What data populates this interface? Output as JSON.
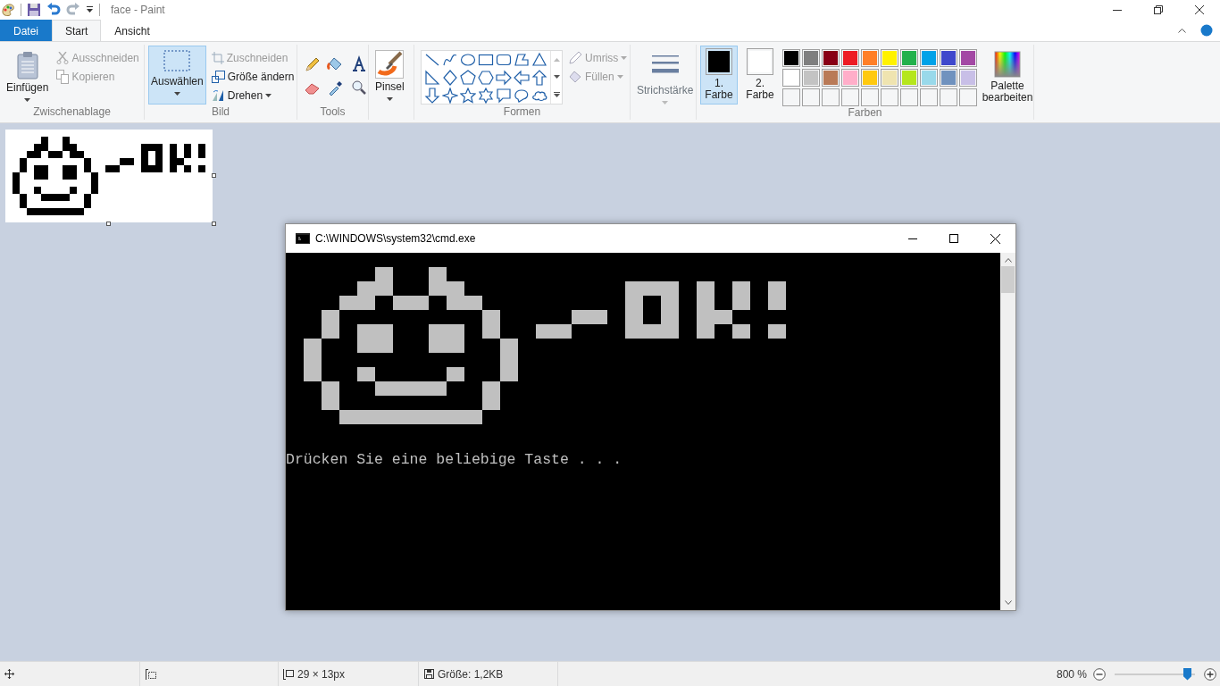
{
  "window": {
    "title": "face - Paint"
  },
  "tabs": [
    {
      "label": "Datei",
      "kind": "file",
      "selected": false
    },
    {
      "label": "Start",
      "kind": "tab",
      "selected": true
    },
    {
      "label": "Ansicht",
      "kind": "tab",
      "selected": false
    }
  ],
  "clipboard": {
    "label": "Zwischenablage",
    "paste": {
      "label": "Einfügen"
    },
    "cut": {
      "label": "Ausschneiden",
      "disabled": true
    },
    "copy": {
      "label": "Kopieren",
      "disabled": true
    }
  },
  "image": {
    "label": "Bild",
    "select": {
      "label": "Auswählen",
      "selected": true
    },
    "crop": {
      "label": "Zuschneiden",
      "disabled": true
    },
    "resize": {
      "label": "Größe ändern",
      "disabled": false
    },
    "rotate": {
      "label": "Drehen",
      "disabled": false
    }
  },
  "tools": {
    "label": "Tools"
  },
  "brushes": {
    "label": "Pinsel"
  },
  "shapes": {
    "label": "Formen",
    "outline": {
      "label": "Umriss",
      "disabled": true
    },
    "fill": {
      "label": "Füllen",
      "disabled": true
    }
  },
  "size": {
    "label": "Strichstärke",
    "disabled": true
  },
  "colors": {
    "label": "Farben",
    "color1": {
      "label": "1. Farbe",
      "selected": true,
      "color": "#000000"
    },
    "color2": {
      "label": "2. Farbe",
      "selected": false,
      "color": "#ffffff"
    },
    "palette": [
      {
        "color": "#000000"
      },
      {
        "color": "#7f7f7f"
      },
      {
        "color": "#880015"
      },
      {
        "color": "#ed1c24"
      },
      {
        "color": "#ff7f27"
      },
      {
        "color": "#fff200"
      },
      {
        "color": "#22b14c"
      },
      {
        "color": "#00a2e8"
      },
      {
        "color": "#3f48cc"
      },
      {
        "color": "#a349a4"
      },
      {
        "color": "#ffffff"
      },
      {
        "color": "#c3c3c3"
      },
      {
        "color": "#b97a57"
      },
      {
        "color": "#ffaec9"
      },
      {
        "color": "#ffc90e"
      },
      {
        "color": "#efe4b0"
      },
      {
        "color": "#b5e61d"
      },
      {
        "color": "#99d9ea"
      },
      {
        "color": "#7092be"
      },
      {
        "color": "#c8bfe7"
      }
    ],
    "edit": {
      "label": "Palette bearbeiten"
    }
  },
  "cmd_window": {
    "title": "C:\\WINDOWS\\system32\\cmd.exe",
    "output": "Drücken Sie eine beliebige Taste . . ."
  },
  "status_bar": {
    "image_size": "29 × 13px",
    "file_size": "Größe: 1,2KB",
    "zoom": "800 %",
    "zoom_slider": {
      "level": 0.9
    }
  }
}
